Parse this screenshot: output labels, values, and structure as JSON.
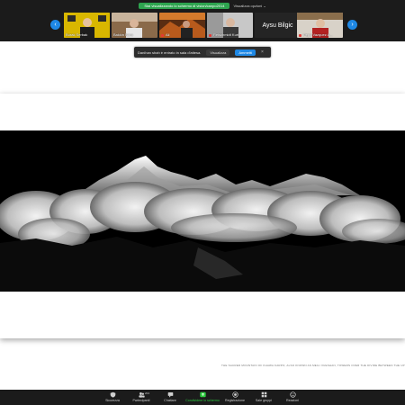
{
  "share_banner": {
    "status": "Stai visualizzando lo schermo di vision/canpo2014",
    "options_label": "Visualizza opzioni ⌄"
  },
  "gallery": {
    "participants": [
      {
        "name": "Burak Serbak",
        "muted": false
      },
      {
        "name": "Bakkin Noro",
        "muted": false
      },
      {
        "name": "Ali",
        "muted": true
      },
      {
        "name": "Reischmidt Kurt",
        "muted": true
      },
      {
        "name": "Aysu Bilgic",
        "muted": false
      },
      {
        "name": "Pepo Vazquez A...",
        "muted": true
      }
    ]
  },
  "toast": {
    "message": "Danihan shah è entrato in sala d'attesa.",
    "view_label": "Visualizza",
    "admit_label": "Ammetti"
  },
  "slide": {
    "caption": "THE SACRED MOUNTAIN OF KHAWA KARPO, ALSO KNOWN AS MEILI XUESHAN, TOWERS OVER THE DIVIDE BETWEEN THE UPPER MEKONG"
  },
  "toolbar": {
    "items": [
      {
        "label": "Sicurezza",
        "icon": "shield-icon"
      },
      {
        "label": "Partecipanti",
        "icon": "participants-icon",
        "count": "204"
      },
      {
        "label": "Chattare",
        "icon": "chat-icon"
      },
      {
        "label": "Condividere lo schermo",
        "icon": "share-screen-icon",
        "active": true
      },
      {
        "label": "Registrazione",
        "icon": "record-icon"
      },
      {
        "label": "Sale gruppi",
        "icon": "breakout-icon"
      },
      {
        "label": "Reazioni",
        "icon": "reaction-icon"
      }
    ]
  },
  "colors": {
    "accent": "#1e88e5",
    "share_green": "#2ea44f",
    "toolbar_bg": "#1b1b1b"
  }
}
